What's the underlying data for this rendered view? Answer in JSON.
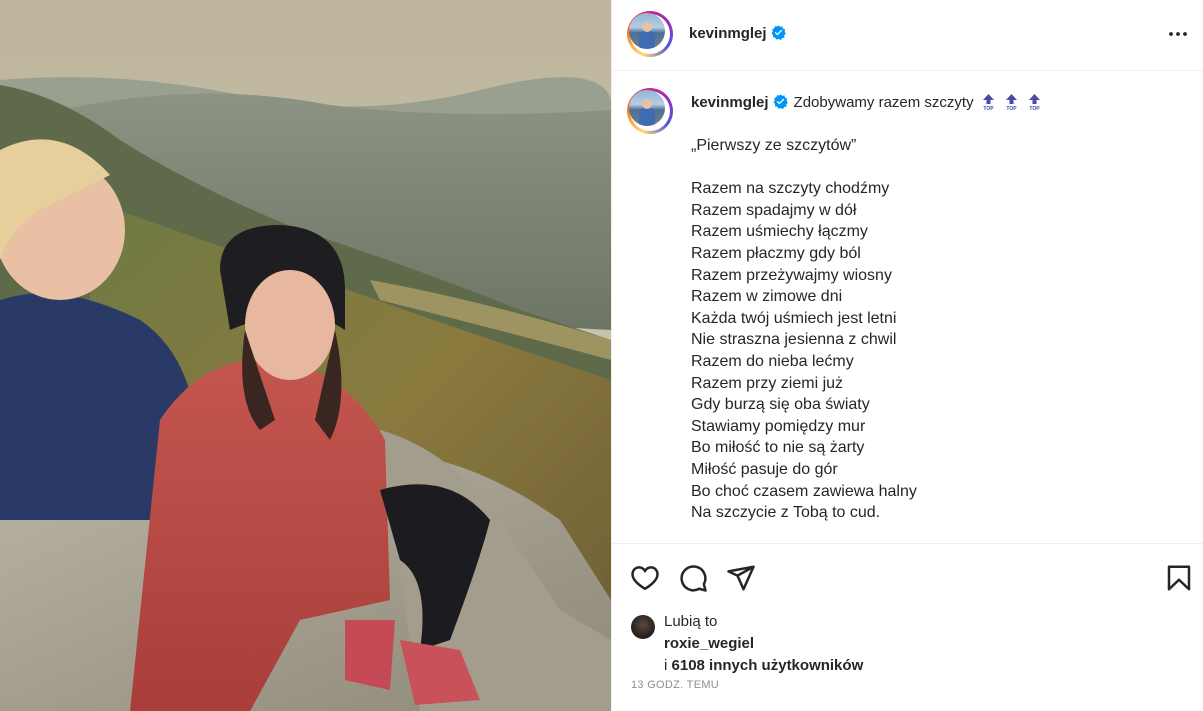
{
  "post": {
    "image_alt": "Selfie of a couple sitting on rocks on a mountain summit"
  },
  "header": {
    "username": "kevinmglej",
    "verified": true,
    "more_icon": "more-horizontal-icon"
  },
  "caption": {
    "username": "kevinmglej",
    "text": "Zdobywamy razem szczyty",
    "emoji_count": 3,
    "emoji_name": "top-arrow-emoji",
    "title_line": "„Pierwszy ze szczytów”",
    "lines": [
      "Razem na szczyty chodźmy",
      "Razem spadajmy w dół",
      "Razem uśmiechy łączmy",
      "Razem płaczmy gdy ból",
      "Razem przeżywajmy wiosny",
      "Razem w zimowe dni",
      "Każda twój uśmiech jest letni",
      "Nie straszna jesienna z chwil",
      "Razem do nieba lećmy",
      "Razem przy ziemi już",
      "Gdy burzą się oba światy",
      "Stawiamy pomiędzy mur",
      "Bo miłość to nie są żarty",
      "Miłość pasuje do gór",
      "Bo choć czasem zawiewa halny",
      "Na szczycie z Tobą to cud."
    ]
  },
  "actions": {
    "like_icon": "heart-icon",
    "comment_icon": "comment-icon",
    "share_icon": "send-icon",
    "save_icon": "bookmark-icon"
  },
  "likes": {
    "label": "Lubią to",
    "first_liker": "roxie_wegiel",
    "prefix": "i",
    "others_text": "6108 innych użytkowników"
  },
  "timestamp": "13 GODZ. TEMU",
  "colors": {
    "verified": "#0095f6",
    "text": "#262626",
    "muted": "#8e8e8e",
    "divider": "#efefef"
  }
}
